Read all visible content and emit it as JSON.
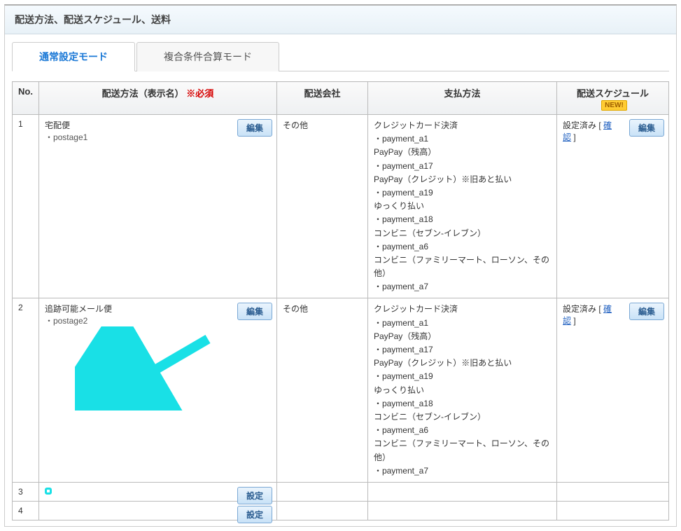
{
  "header": {
    "title": "配送方法、配送スケジュール、送料"
  },
  "tabs": [
    {
      "label": "通常設定モード",
      "active": true
    },
    {
      "label": "複合条件合算モード",
      "active": false
    }
  ],
  "columns": {
    "no": "No.",
    "method": "配送方法（表示名）",
    "required": "※必須",
    "company": "配送会社",
    "payment": "支払方法",
    "schedule": "配送スケジュール",
    "new": "NEW!"
  },
  "buttons": {
    "edit": "編集",
    "set": "設定",
    "confirm": "確認"
  },
  "schedule_status": "設定済み",
  "rows": [
    {
      "no": "1",
      "method_name": "宅配便",
      "method_code": "・postage1",
      "company": "その他",
      "payments": [
        "クレジットカード決済",
        "・payment_a1",
        "PayPay（残高）",
        "・payment_a17",
        "PayPay（クレジット）※旧あと払い",
        "・payment_a19",
        "ゆっくり払い",
        "・payment_a18",
        "コンビニ（セブン-イレブン）",
        "・payment_a6",
        "コンビニ（ファミリーマート、ローソン、その他）",
        "・payment_a7"
      ],
      "configured": true
    },
    {
      "no": "2",
      "method_name": "追跡可能メール便",
      "method_code": "・postage2",
      "company": "その他",
      "payments": [
        "クレジットカード決済",
        "・payment_a1",
        "PayPay（残高）",
        "・payment_a17",
        "PayPay（クレジット）※旧あと払い",
        "・payment_a19",
        "ゆっくり払い",
        "・payment_a18",
        "コンビニ（セブン-イレブン）",
        "・payment_a6",
        "コンビニ（ファミリーマート、ローソン、その他）",
        "・payment_a7"
      ],
      "configured": true
    },
    {
      "no": "3",
      "highlight": true
    },
    {
      "no": "4"
    }
  ],
  "annotation": {
    "arrow_color": "#19e0e6"
  }
}
